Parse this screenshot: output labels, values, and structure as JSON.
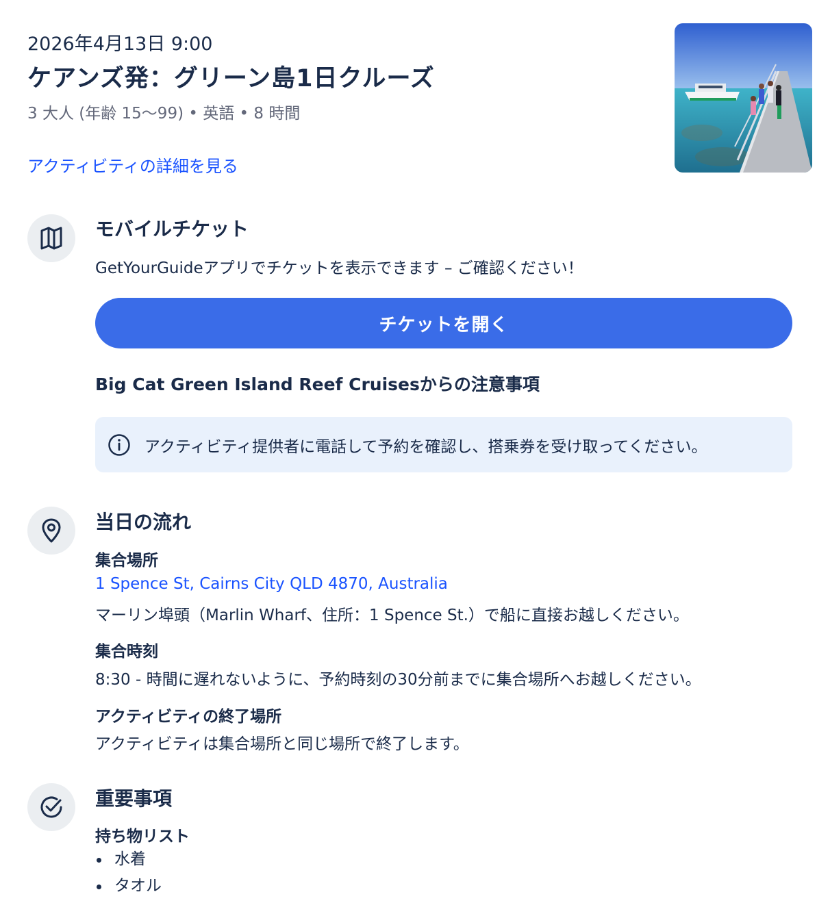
{
  "booking": {
    "date": "2026年4月13日 9:00",
    "title": "ケアンズ発：グリーン島1日クルーズ",
    "meta": "3 大人 (年齢 15〜99) • 英語 • 8 時間",
    "details_link": "アクティビティの詳細を見る"
  },
  "ticket": {
    "title": "モバイルチケット",
    "description": "GetYourGuideアプリでチケットを表示できます – ご確認ください！",
    "open_button": "チケットを開く",
    "notice_heading": "Big Cat Green Island Reef Cruisesからの注意事項",
    "notice_text": "アクティビティ提供者に電話して予約を確認し、搭乗券を受け取ってください。"
  },
  "itinerary": {
    "title": "当日の流れ",
    "meeting_point_label": "集合場所",
    "meeting_point_address": "1 Spence St, Cairns City QLD 4870, Australia",
    "meeting_point_note": "マーリン埠頭（Marlin Wharf、住所：1 Spence St.）で船に直接お越しください。",
    "meeting_time_label": "集合時刻",
    "meeting_time_text": "8:30 - 時間に遅れないように、予約時刻の30分前までに集合場所へお越しください。",
    "end_point_label": "アクティビティの終了場所",
    "end_point_text": "アクティビティは集合場所と同じ場所で終了します。"
  },
  "important": {
    "title": "重要事項",
    "packing_label": "持ち物リスト",
    "items": [
      "水着",
      "タオル"
    ]
  },
  "icons": {
    "ticket": "map-ticket-icon",
    "info": "info-icon",
    "location": "location-pin-icon",
    "check": "check-circle-icon"
  },
  "colors": {
    "accent": "#3a6ce8",
    "link": "#1a53ff",
    "notice_bg": "#e9f1fc",
    "icon_circle": "#ebeef1"
  }
}
